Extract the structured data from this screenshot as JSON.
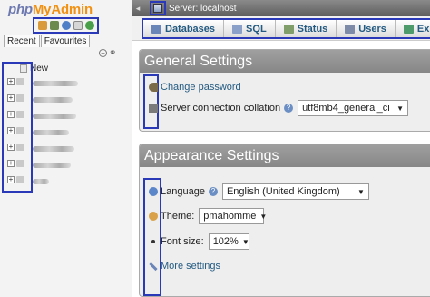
{
  "nav": {
    "logo_php": "php",
    "logo_myadmin": "MyAdmin",
    "quick_icons": [
      "home-icon",
      "logout-icon",
      "help-icon",
      "docs-icon",
      "reload-icon"
    ],
    "tabs": [
      "Recent",
      "Favourites"
    ],
    "new_label": "New",
    "db_count": 8
  },
  "topbar": {
    "collapse_glyph": "◂",
    "breadcrumb": "Server: localhost"
  },
  "tabs": [
    {
      "label": "Databases",
      "icon": "databases-icon",
      "color": "#6a86b8"
    },
    {
      "label": "SQL",
      "icon": "sql-icon",
      "color": "#8aa0c8"
    },
    {
      "label": "Status",
      "icon": "status-icon",
      "color": "#7f9e6a"
    },
    {
      "label": "Users",
      "icon": "users-icon",
      "color": "#7d8aa8"
    },
    {
      "label": "Export",
      "icon": "export-icon",
      "color": "#4d9a6a"
    }
  ],
  "general": {
    "title": "General Settings",
    "change_password": "Change password",
    "collation_label": "Server connection collation",
    "collation_value": "utf8mb4_general_ci"
  },
  "appearance": {
    "title": "Appearance Settings",
    "language_label": "Language",
    "language_value": "English (United Kingdom)",
    "theme_label": "Theme:",
    "theme_value": "pmahomme",
    "font_label": "Font size:",
    "font_value": "102%",
    "more_settings": "More settings"
  },
  "help_glyph": "?",
  "colors": {
    "accent": "#2a39b8",
    "link": "#235a81",
    "logo_orange": "#f29111",
    "logo_blue": "#6c78af"
  }
}
